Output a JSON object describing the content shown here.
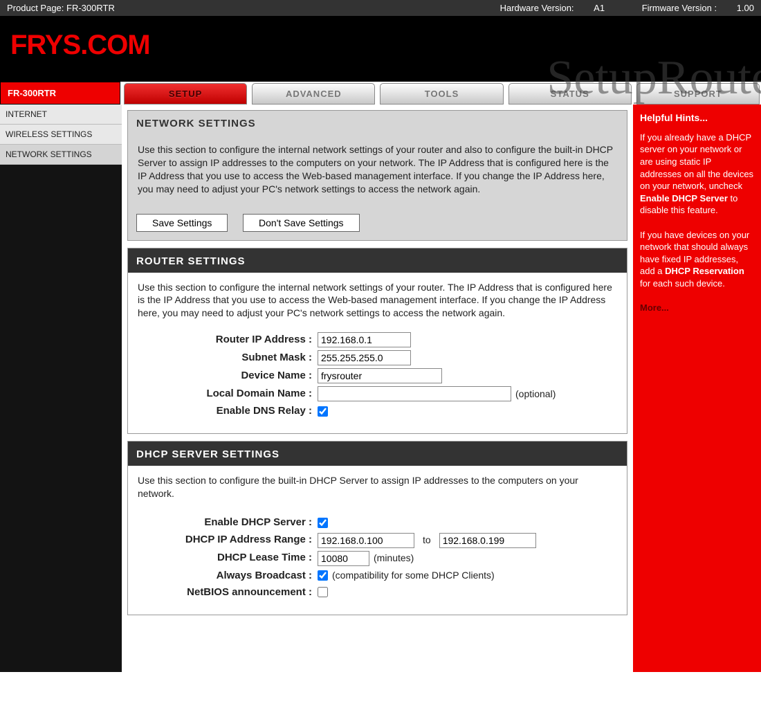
{
  "topbar": {
    "product_page_label": "Product Page: ",
    "product_page_value": "FR-300RTR",
    "hardware_label": "Hardware Version: ",
    "hardware_value": "A1",
    "firmware_label": "Firmware Version : ",
    "firmware_value": "1.00"
  },
  "logo": "FRYS.COM",
  "watermark": "SetupRouter.co",
  "device_tab": "FR-300RTR",
  "tabs": {
    "setup": "SETUP",
    "advanced": "ADVANCED",
    "tools": "TOOLS",
    "status": "STATUS",
    "support": "SUPPORT"
  },
  "sidebar": {
    "internet": "INTERNET",
    "wireless": "WIRELESS SETTINGS",
    "network": "NETWORK SETTINGS"
  },
  "network_settings": {
    "title": "NETWORK SETTINGS",
    "desc": "Use this section to configure the internal network settings of your router and also to configure the built-in DHCP Server to assign IP addresses to the computers on your network. The IP Address that is configured here is the IP Address that you use to access the Web-based management interface. If you change the IP Address here, you may need to adjust your PC's network settings to access the network again.",
    "save": "Save Settings",
    "dont_save": "Don't Save Settings"
  },
  "router_settings": {
    "title": "ROUTER SETTINGS",
    "desc": "Use this section to configure the internal network settings of your router. The IP Address that is configured here is the IP Address that you use to access the Web-based management interface. If you change the IP Address here, you may need to adjust your PC's network settings to access the network again.",
    "ip_label": "Router IP Address :",
    "ip_value": "192.168.0.1",
    "mask_label": "Subnet Mask :",
    "mask_value": "255.255.255.0",
    "device_label": "Device Name :",
    "device_value": "frysrouter",
    "domain_label": "Local Domain Name :",
    "domain_value": "",
    "domain_suffix": "(optional)",
    "dns_relay_label": "Enable DNS Relay :"
  },
  "dhcp": {
    "title": "DHCP SERVER SETTINGS",
    "desc": "Use this section to configure the built-in DHCP Server to assign IP addresses to the computers on your network.",
    "enable_label": "Enable DHCP Server :",
    "range_label": "DHCP IP Address Range :",
    "range_from": "192.168.0.100",
    "range_to_word": "to",
    "range_to": "192.168.0.199",
    "lease_label": "DHCP Lease Time :",
    "lease_value": "10080",
    "lease_suffix": "(minutes)",
    "broadcast_label": "Always Broadcast :",
    "broadcast_suffix": "(compatibility for some DHCP Clients)",
    "netbios_label": "NetBIOS announcement :"
  },
  "hints": {
    "title": "Helpful Hints...",
    "p1a": "If you already have a DHCP server on your network or are using static IP addresses on all the devices on your network, uncheck ",
    "p1b": "Enable DHCP Server",
    "p1c": " to disable this feature.",
    "p2a": "If you have devices on your network that should always have fixed IP addresses, add a ",
    "p2b": "DHCP Reservation",
    "p2c": " for each such device.",
    "more": "More..."
  }
}
